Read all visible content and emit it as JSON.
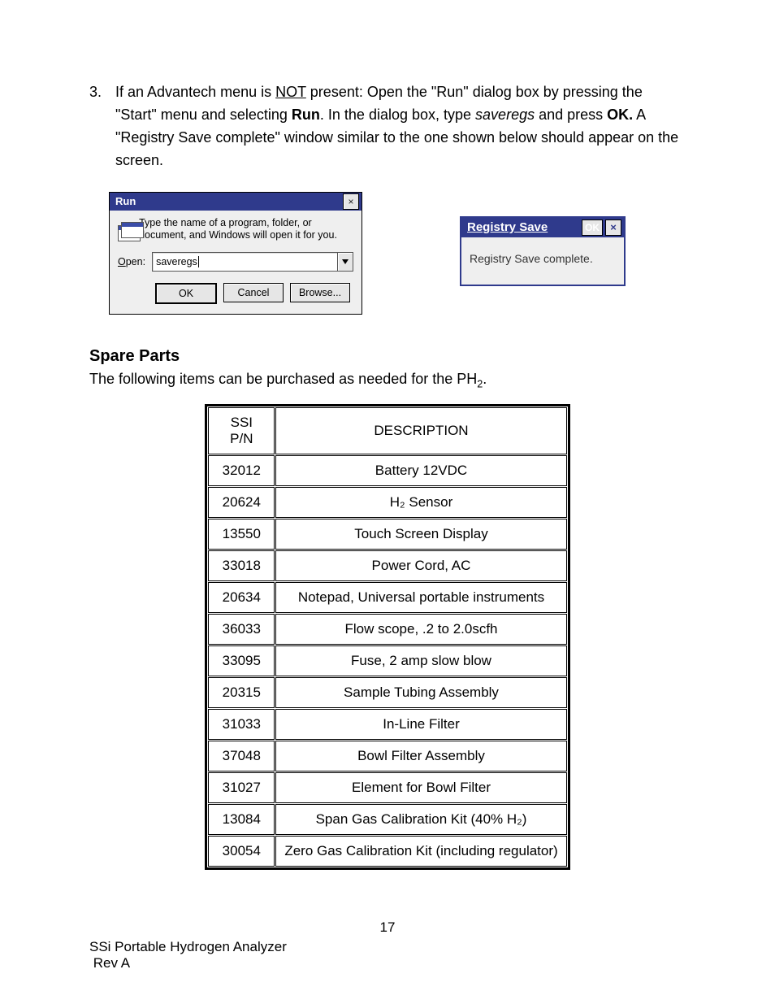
{
  "step": {
    "number": "3.",
    "prefix": "If an Advantech menu is ",
    "not": "NOT",
    "mid1": " present: Open the \"Run\" dialog box by pressing the \"Start\" menu and selecting ",
    "run": "Run",
    "mid2": ". In the dialog box, type ",
    "cmd": "saveregs",
    "mid3": " and press ",
    "ok": "OK.",
    "tail": " A \"Registry Save complete\" window similar to the one shown below should appear on the screen."
  },
  "runDialog": {
    "title": "Run",
    "message": "Type the name of a program, folder, or document, and Windows will open it for you.",
    "openLabel": "Open:",
    "openUnderline": "O",
    "value": "saveregs",
    "buttons": {
      "ok": "OK",
      "cancel": "Cancel",
      "browse": "Browse..."
    }
  },
  "regDialog": {
    "title": "Registry Save",
    "ok": "OK",
    "message": "Registry Save complete."
  },
  "spare": {
    "heading": "Spare Parts",
    "introPrefix": "The following items can be purchased as needed for the PH",
    "introSub": "2",
    "introSuffix": ".",
    "headers": {
      "pn": "SSI P/N",
      "desc": "DESCRIPTION"
    },
    "rows": [
      {
        "pn": "32012",
        "desc": "Battery 12VDC"
      },
      {
        "pn": "20624",
        "desc": "H₂ Sensor"
      },
      {
        "pn": "13550",
        "desc": "Touch Screen Display"
      },
      {
        "pn": "33018",
        "desc": "Power Cord, AC"
      },
      {
        "pn": "20634",
        "desc": "Notepad, Universal portable instruments"
      },
      {
        "pn": "36033",
        "desc": "Flow scope, .2 to 2.0scfh"
      },
      {
        "pn": "33095",
        "desc": "Fuse, 2 amp slow blow"
      },
      {
        "pn": "20315",
        "desc": "Sample Tubing Assembly"
      },
      {
        "pn": "31033",
        "desc": "In-Line Filter"
      },
      {
        "pn": "37048",
        "desc": "Bowl Filter Assembly"
      },
      {
        "pn": "31027",
        "desc": "Element for Bowl Filter"
      },
      {
        "pn": "13084",
        "desc": "Span Gas Calibration Kit (40% H₂)"
      },
      {
        "pn": "30054",
        "desc": "Zero Gas Calibration Kit (including regulator)"
      }
    ]
  },
  "footer": {
    "pageNumber": "17",
    "line1": "SSi Portable Hydrogen Analyzer",
    "line2": "Rev A"
  }
}
